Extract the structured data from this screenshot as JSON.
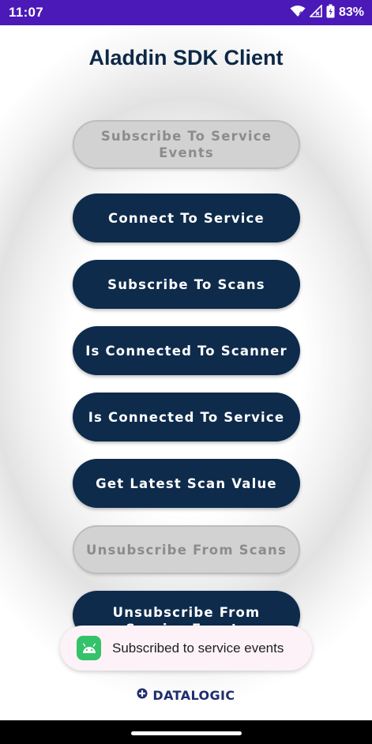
{
  "status_bar": {
    "time": "11:07",
    "battery_percent": "83%",
    "background_color": "#4b19b7",
    "icons": [
      "wifi-icon",
      "signal-icon",
      "battery-icon"
    ]
  },
  "app": {
    "title": "Aladdin SDK Client",
    "title_color": "#0d2847"
  },
  "buttons": [
    {
      "label": "Subscribe To Service Events",
      "enabled": false
    },
    {
      "label": "Connect To Service",
      "enabled": true
    },
    {
      "label": "Subscribe To Scans",
      "enabled": true
    },
    {
      "label": "Is Connected To Scanner",
      "enabled": true
    },
    {
      "label": "Is Connected To Service",
      "enabled": true
    },
    {
      "label": "Get Latest Scan Value",
      "enabled": true
    },
    {
      "label": "Unsubscribe From Scans",
      "enabled": false
    },
    {
      "label": "Unsubscribe From Service Events",
      "enabled": true
    }
  ],
  "colors": {
    "button_active": "#0e2b4c",
    "button_disabled": "#d2d2d2"
  },
  "toast": {
    "message": "Subscribed to service events",
    "icon": "android-icon"
  },
  "footer": {
    "brand": "DATALOGIC"
  }
}
